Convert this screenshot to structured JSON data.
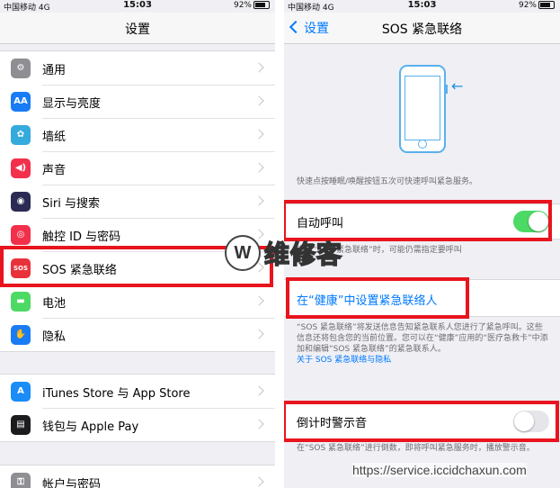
{
  "left": {
    "status": {
      "carrier": "中国移动",
      "network": "4G",
      "time": "15:03",
      "battery": "92%"
    },
    "nav_title": "设置",
    "group1": [
      {
        "label": "通用",
        "icon": "gear-icon",
        "color": "#8e8e93",
        "glyph": "⚙"
      },
      {
        "label": "显示与亮度",
        "icon": "text-size-icon",
        "color": "#1a7cf5",
        "glyph": "AA"
      },
      {
        "label": "墙纸",
        "icon": "flower-icon",
        "color": "#35aadc",
        "glyph": "✿"
      },
      {
        "label": "声音",
        "icon": "speaker-icon",
        "color": "#f2304b",
        "glyph": "◀)"
      },
      {
        "label": "Siri 与搜索",
        "icon": "siri-icon",
        "color": "#2a2a55",
        "glyph": "◉"
      },
      {
        "label": "触控 ID 与密码",
        "icon": "fingerprint-icon",
        "color": "#f2304b",
        "glyph": "◎"
      },
      {
        "label": "SOS 紧急联络",
        "icon": "sos-icon",
        "color": "#e8323a",
        "glyph": "SOS"
      },
      {
        "label": "电池",
        "icon": "battery-icon",
        "color": "#4cd964",
        "glyph": "▬"
      },
      {
        "label": "隐私",
        "icon": "hand-icon",
        "color": "#1a7cf5",
        "glyph": "✋"
      }
    ],
    "group2": [
      {
        "label": "iTunes Store 与 App Store",
        "icon": "app-store-icon",
        "color": "#1a8cf5",
        "glyph": "A"
      },
      {
        "label": "钱包与 Apple Pay",
        "icon": "wallet-icon",
        "color": "#1c1c1e",
        "glyph": "▤"
      }
    ],
    "group3": [
      {
        "label": "帐户与密码",
        "icon": "key-icon",
        "color": "#8e8e93",
        "glyph": "⚿"
      }
    ]
  },
  "right": {
    "status": {
      "carrier": "中国移动",
      "network": "4G",
      "time": "15:03",
      "battery": "92%"
    },
    "back_label": "设置",
    "nav_title": "SOS 紧急联络",
    "intro": "快速点按睡眠/唤醒按钮五次可快速呼叫紧急服务。",
    "auto_call": {
      "label": "自动呼叫",
      "on": true
    },
    "auto_call_note": "启用“SOS 紧急联络”时，可能仍需指定要呼叫",
    "health_link": "在“健康”中设置紧急联络人",
    "health_note": "“SOS 紧急联络”将发送信息告知紧急联系人您进行了紧急呼叫。这些信息还将包含您的当前位置。您可以在“健康”应用的“医疗急救卡”中添加和编辑“SOS 紧急联络”的紧急联系人。",
    "about_link": "关于 SOS 紧急联络与隐私",
    "countdown": {
      "label": "倒计时警示音",
      "on": false
    },
    "countdown_note": "在“SOS 紧急联络”进行倒数，即将呼叫紧急服务时，播放警示音。"
  },
  "watermark": {
    "letter": "W",
    "text": "维修客"
  },
  "url": "https://service.iccidchaxun.com",
  "colors": {
    "highlight": "#e8141e",
    "link": "#007aff",
    "toggle_on": "#4cd964"
  }
}
